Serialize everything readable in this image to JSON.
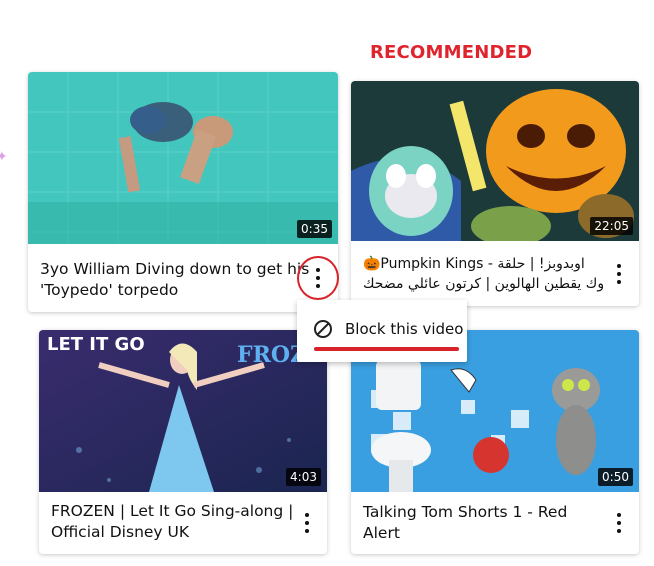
{
  "section": {
    "title": "RECOMMENDED"
  },
  "videos": [
    {
      "title_line1": "3yo William Diving down to get his",
      "title_line2": "'Toypedo' torpedo",
      "duration": "0:35"
    },
    {
      "title_line1": "🎃Pumpkin Kings - اوبدوبز! | حلقة",
      "title_line2": "ملوك يقطين الهالوين | كرتون عائلي مضحك...",
      "duration": "22:05"
    },
    {
      "title_line1": "FROZEN | Let It Go Sing-along |",
      "title_line2": "Official Disney UK",
      "duration": "4:03",
      "thumb_text": "LET IT GO",
      "thumb_logo": "FROZ"
    },
    {
      "title_line1": "Talking Tom Shorts 1 - Red Alert",
      "title_line2": "",
      "duration": "0:50"
    }
  ],
  "menu": {
    "block_label": "Block this video",
    "icon": "block-icon"
  },
  "colors": {
    "accent": "#e0242e",
    "annotation": "#d8232a"
  }
}
